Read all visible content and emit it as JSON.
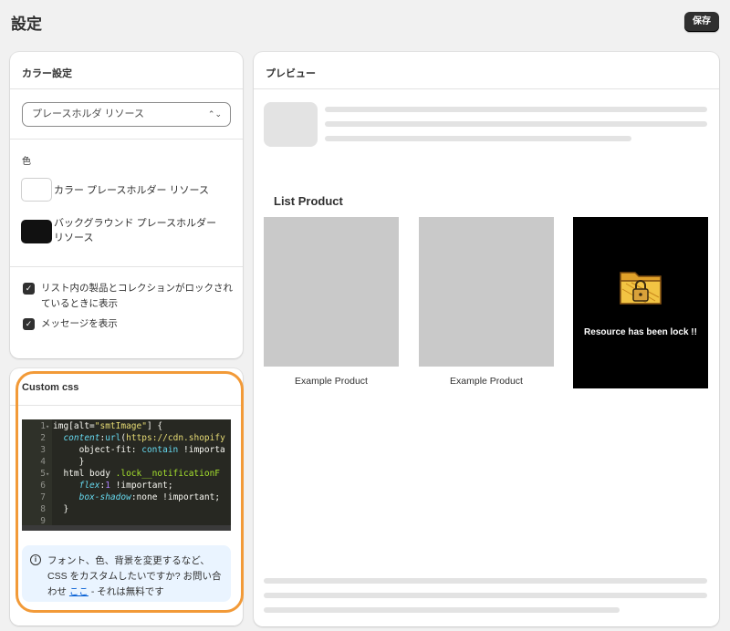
{
  "page": {
    "title": "設定",
    "save_label": "保存"
  },
  "color_settings": {
    "title": "カラー設定",
    "select_value": "プレースホルダ リソース",
    "color_section_label": "色",
    "swatches": [
      {
        "label": "カラー プレースホルダー リソース",
        "color": "#ffffff"
      },
      {
        "label": "バックグラウンド プレースホルダー リソース",
        "color": "#111111"
      }
    ],
    "checkboxes": [
      {
        "label": "リスト内の製品とコレクションがロックされているときに表示",
        "checked": true
      },
      {
        "label": "メッセージを表示",
        "checked": true
      }
    ]
  },
  "custom_css": {
    "title": "Custom css",
    "code_lines": [
      "1",
      "2",
      "3",
      "4",
      "5",
      "6",
      "7",
      "8",
      "9"
    ],
    "info_text": "フォント、色、背景を変更するなど、CSS をカスタムしたいですか? お問い合わせ",
    "info_link": "ここ",
    "info_suffix": " - それは無料です"
  },
  "preview": {
    "title": "プレビュー",
    "list_title": "List Product",
    "products": [
      {
        "name": "Example Product"
      },
      {
        "name": "Example Product"
      }
    ],
    "locked_message": "Resource has been lock !!"
  },
  "colors": {
    "accent_ring": "#f29a38",
    "primary_button": "#303030",
    "link": "#005bd3"
  }
}
